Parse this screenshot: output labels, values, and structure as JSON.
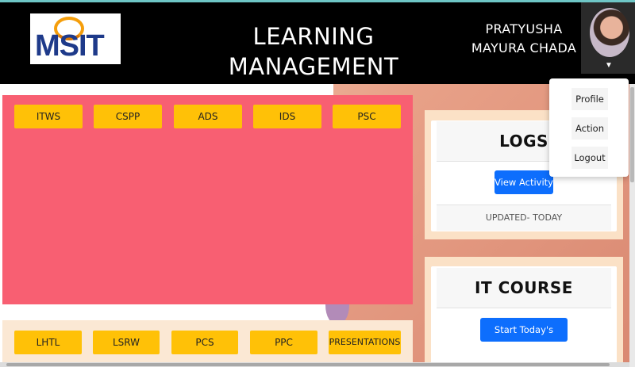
{
  "header": {
    "logo_text": "MSIT",
    "title": "LEARNING MANAGEMENT SYSTEM",
    "user_name": "PRATYUSHA MAYURA CHADA"
  },
  "courses_top": [
    "ITWS",
    "CSPP",
    "ADS",
    "IDS",
    "PSC"
  ],
  "courses_bottom": [
    "LHTL",
    "LSRW",
    "PCS",
    "PPC",
    "PRESENTATIONS"
  ],
  "logs_card": {
    "title": "LOGS",
    "button": "View Activity",
    "footer": "UPDATED- TODAY"
  },
  "it_course_card": {
    "title": "IT COURSE",
    "button": "Start Today's Module"
  },
  "user_menu": [
    "Profile",
    "Action",
    "Logout"
  ],
  "colors": {
    "header_bg": "#000000",
    "course_button": "#ffc107",
    "pink_panel": "#f85f72",
    "primary_button": "#0d6efd",
    "card_outer": "#fbe1c6"
  }
}
